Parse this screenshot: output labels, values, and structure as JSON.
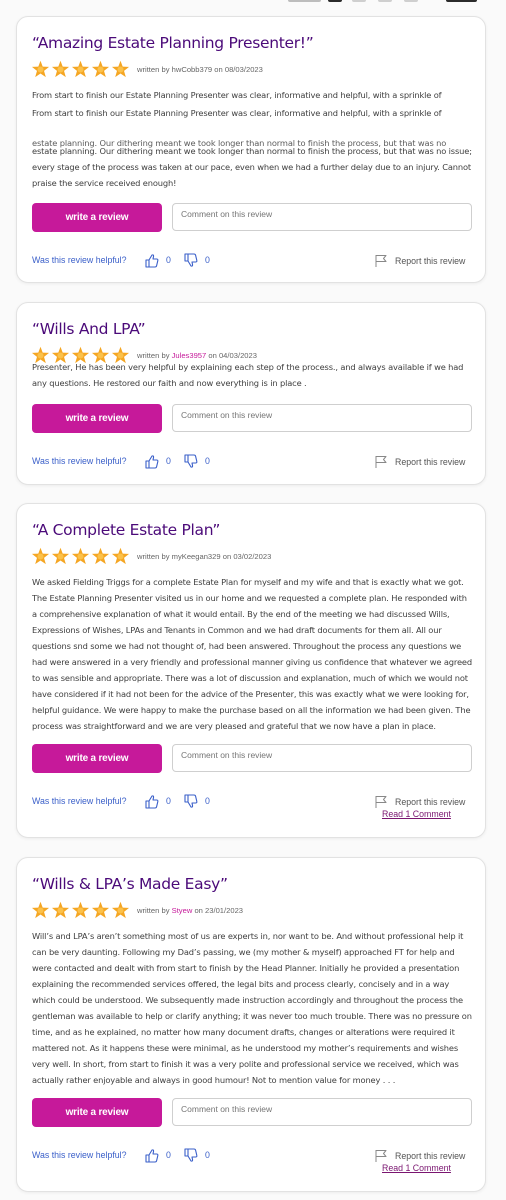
{
  "common": {
    "write_review_label": "write a review",
    "comment_placeholder": "Comment on this review",
    "helpful_label": "Was this review helpful?",
    "report_label": "Report this review",
    "written_by_prefix": "written by",
    "on_word": "on",
    "brand_color": "#c6199a",
    "title_color": "#4b0a79",
    "star_color": "#f5a623"
  },
  "reviews": [
    {
      "title": "“Amazing Estate Planning Presenter!”",
      "rating": 5,
      "author": "hwCobb379",
      "date": "08/03/2023",
      "body_a": "From start to finish our Estate Planning Presenter was clear, informative and helpful, with a sprinkle of",
      "body_b": "From start to finish our Estate Planning Presenter was clear, informative and helpful, with a sprinkle of",
      "body_c": "estate planning. Our dithering meant we took longer than normal to finish the process, but that was no",
      "body_d": "estate planning. Our dithering meant we took longer than normal to finish the process, but that was no issue; every stage of the process was taken at our pace, even when we had a further delay due to an injury. Cannot praise the service received enough!",
      "likes": "0",
      "dislikes": "0"
    },
    {
      "title": "“Wills And LPA”",
      "rating": 5,
      "author": "Jules3957",
      "date": "04/03/2023",
      "body_a": "Presenter,  He has been very helpful by explaining each step of the process., and always available if we had any questions. He restored our faith and now everything is in place .",
      "likes": "0",
      "dislikes": "0"
    },
    {
      "title": "“A Complete Estate Plan”",
      "rating": 5,
      "author": "myKeegan329",
      "date": "03/02/2023",
      "body_a": "We asked Fielding Triggs for a complete Estate Plan for myself and my wife and that is exactly what we got. The Estate Planning Presenter visited us in our home and we requested a complete plan. He responded with a comprehensive explanation of what it would entail. By the end of the meeting we had discussed Wills, Expressions of Wishes, LPAs and Tenants in Common and we had draft documents for them all. All our questions snd some we had not thought of, had been answered. Throughout the process any questions we had were answered in a very friendly and professional manner giving us confidence that whatever we agreed to was sensible and appropriate. There was a lot of discussion and explanation, much of which we would not have considered if it had not been for the advice of the Presenter, this was exactly what we were looking for, helpful guidance. We were happy to make the purchase based on all the information we had been given. The process was straightforward and we are very pleased and grateful that we now have a plan in place.",
      "likes": "0",
      "dislikes": "0",
      "read_comments": "Read 1 Comment"
    },
    {
      "title": "“Wills & LPA’s Made Easy”",
      "rating": 5,
      "author": "Styew",
      "date": "23/01/2023",
      "body_a": "Will’s and LPA’s aren’t something most of us are experts in, nor want to be. And without professional help it can be very daunting. Following my Dad’s passing, we (my mother & myself) approached FT for help and were contacted and dealt with from start to finish by the Head Planner. Initially he provided a presentation explaining the recommended services offered, the legal bits and process clearly, concisely and in a way which could be understood. We subsequently made instruction accordingly and throughout the process the gentleman was available to help or clarify anything; it was never too much trouble. There was no pressure on time, and as he explained, no matter how many document drafts, changes or alterations were required it mattered not. As it happens these were minimal, as he understood my mother’s requirements and wishes very well. In short, from start to finish it was a very polite and professional service we received, which was actually rather enjoyable and always in good humour! Not to mention value for money . . .",
      "likes": "0",
      "dislikes": "0",
      "read_comments": "Read 1 Comment"
    }
  ]
}
